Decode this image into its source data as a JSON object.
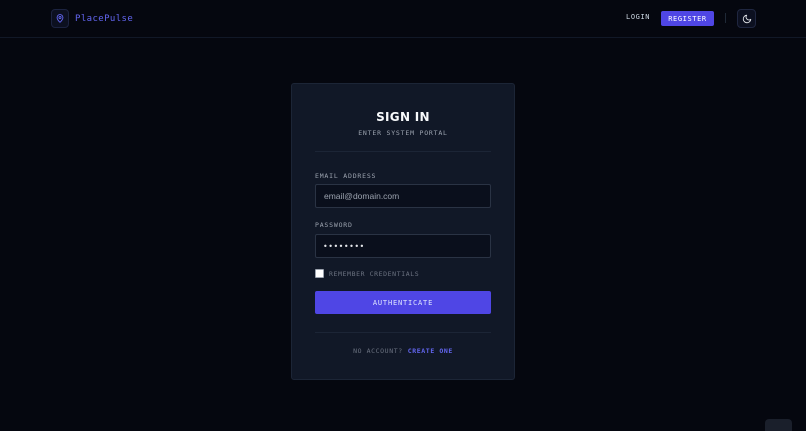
{
  "header": {
    "brand_name": "PlacePulse",
    "brand_icon": "map-pin-icon",
    "login_label": "LOGIN",
    "register_label": "REGISTER",
    "theme_icon": "moon-icon"
  },
  "card": {
    "title": "SIGN IN",
    "subtitle": "ENTER SYSTEM PORTAL",
    "email_label": "EMAIL ADDRESS",
    "email_placeholder": "email@domain.com",
    "email_value": "",
    "password_label": "PASSWORD",
    "password_value": "••••••••",
    "remember_label": "REMEMBER CREDENTIALS",
    "remember_checked": false,
    "submit_label": "AUTHENTICATE",
    "no_account_text": "NO ACCOUNT?",
    "create_link": "CREATE ONE"
  },
  "colors": {
    "background": "#05070f",
    "card": "#111827",
    "accent": "#4f46e5",
    "accent_text": "#6366f1"
  }
}
